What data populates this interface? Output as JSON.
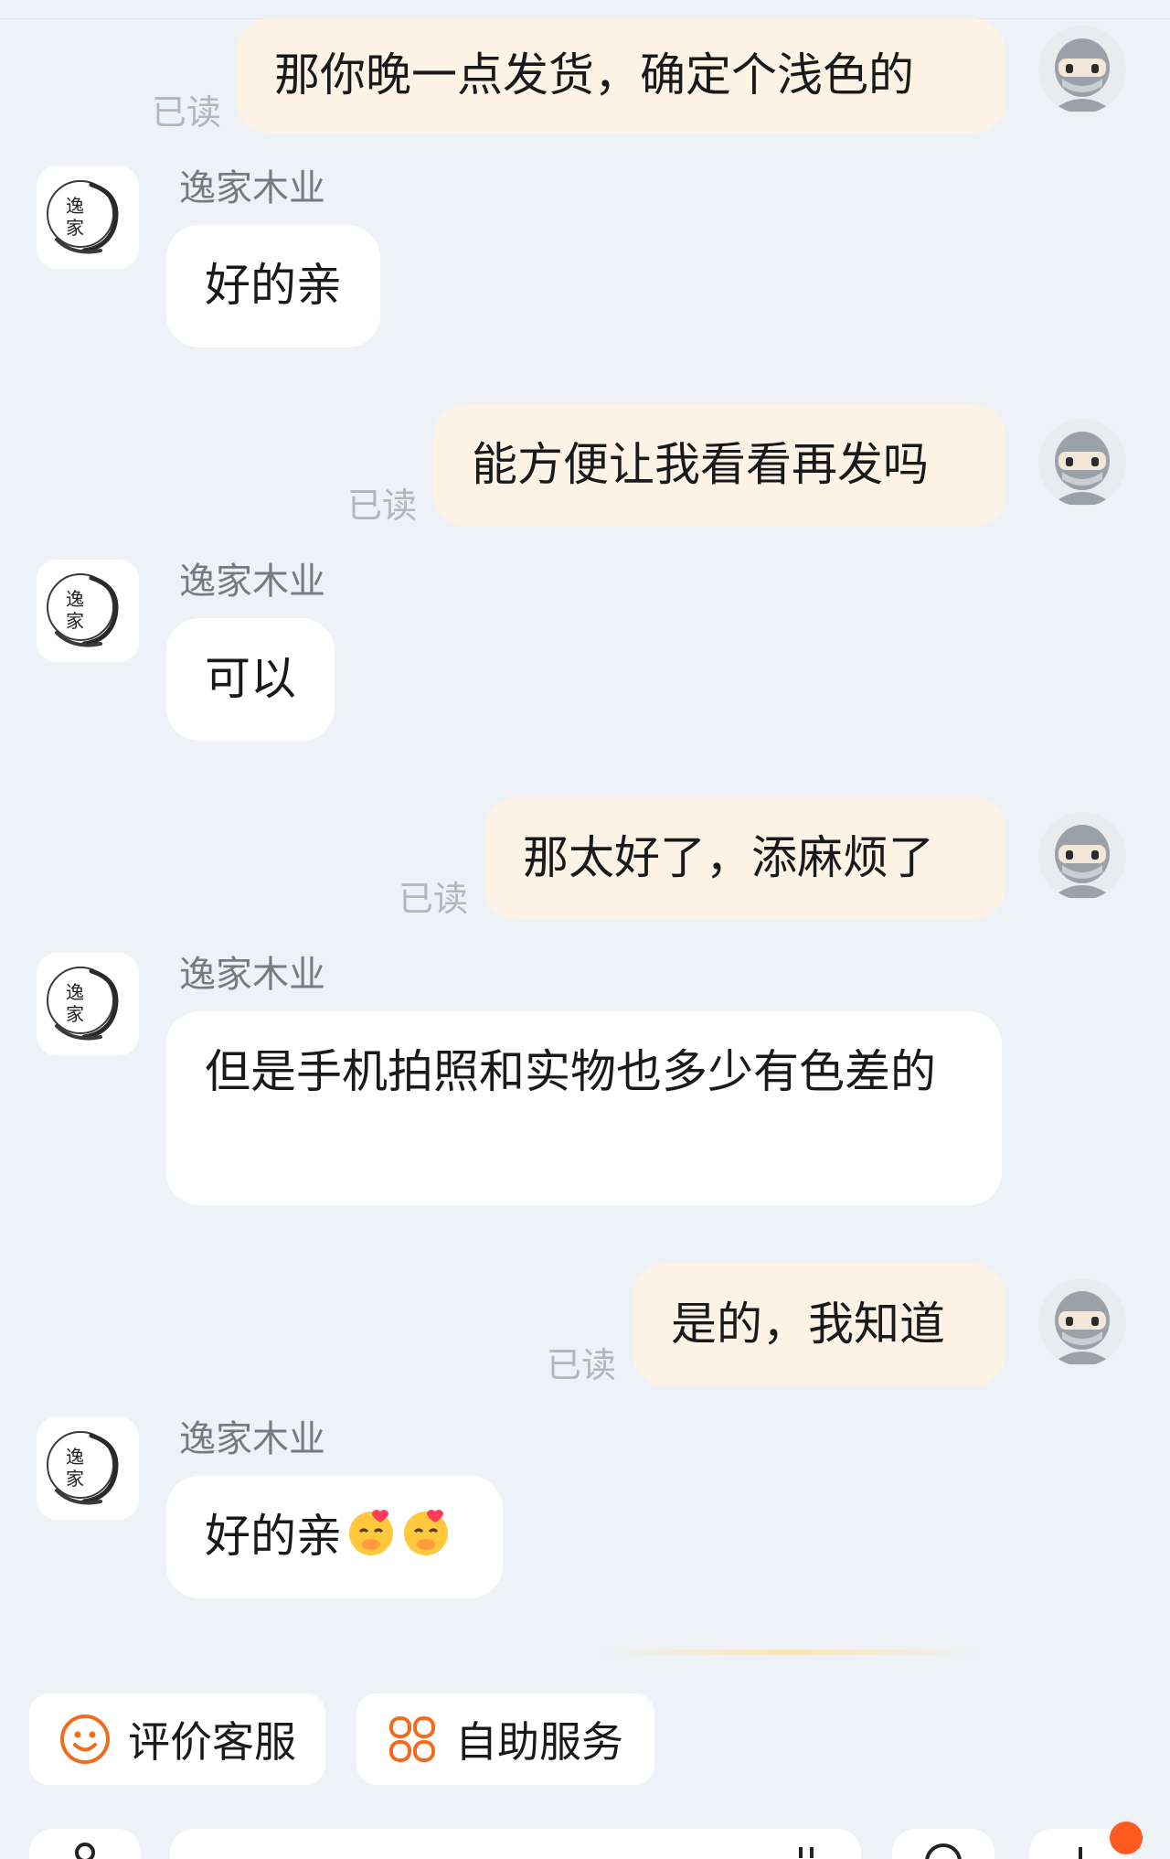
{
  "conversation": {
    "shop_name": "逸家木业",
    "read_label": "已读",
    "messages": [
      {
        "from": "me",
        "text": "那你晚一点发货，确定个浅色的",
        "read": "已读"
      },
      {
        "from": "shop",
        "sender": "逸家木业",
        "text": "好的亲"
      },
      {
        "from": "me",
        "text": "能方便让我看看再发吗",
        "read": "已读"
      },
      {
        "from": "shop",
        "sender": "逸家木业",
        "text": "可以"
      },
      {
        "from": "me",
        "text": "那太好了，添麻烦了",
        "read": "已读"
      },
      {
        "from": "shop",
        "sender": "逸家木业",
        "text": "但是手机拍照和实物也多少有色差的"
      },
      {
        "from": "me",
        "text": "是的，我知道",
        "read": "已读"
      },
      {
        "from": "shop",
        "sender": "逸家木业",
        "text": "好的亲",
        "emojis": [
          "smiling-face-with-hearts-icon",
          "smiling-face-with-hearts-icon"
        ]
      }
    ]
  },
  "shop_avatar": {
    "calligraphy": [
      "逸",
      "家"
    ]
  },
  "quick_actions": [
    {
      "label": "评价客服",
      "icon": "smiley-face-icon"
    },
    {
      "label": "自助服务",
      "icon": "grid-flower-icon"
    }
  ],
  "colors": {
    "background": "#eef1f5",
    "outgoing_bubble": "#fcf3e6",
    "incoming_bubble": "#ffffff",
    "accent": "#f26b1d",
    "read_text": "#b3b6bb"
  }
}
